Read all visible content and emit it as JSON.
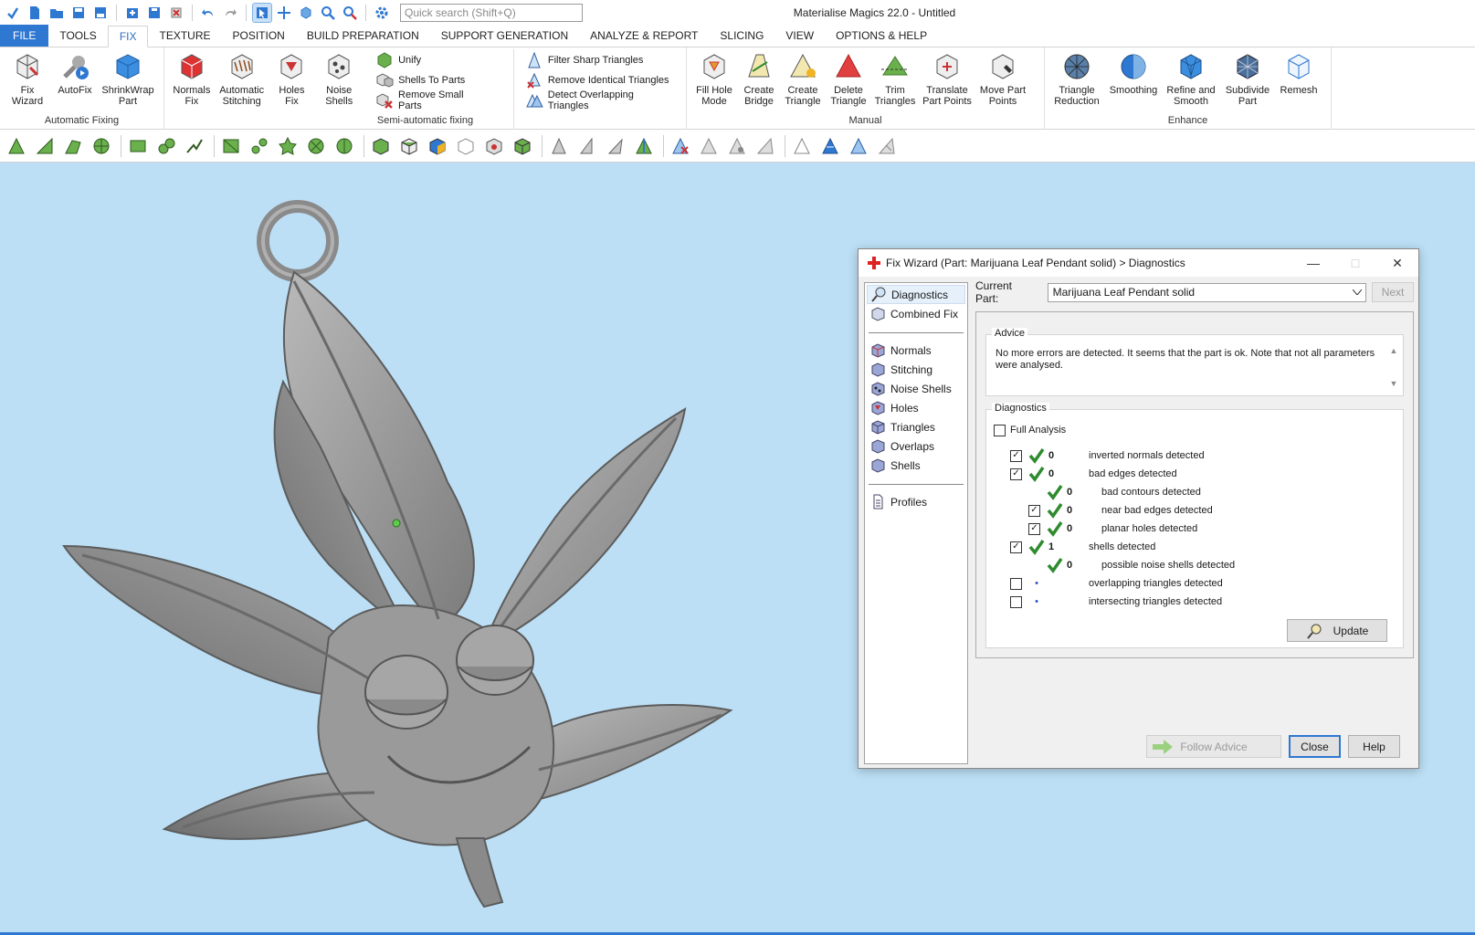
{
  "window": {
    "title": "Materialise Magics 22.0 - Untitled"
  },
  "search": {
    "placeholder": "Quick search (Shift+Q)"
  },
  "menu": {
    "tabs": [
      "FILE",
      "TOOLS",
      "FIX",
      "TEXTURE",
      "POSITION",
      "BUILD PREPARATION",
      "SUPPORT GENERATION",
      "ANALYZE & REPORT",
      "SLICING",
      "VIEW",
      "OPTIONS & HELP"
    ],
    "active": "FIX"
  },
  "ribbon": {
    "automatic_fixing": {
      "label": "Automatic Fixing",
      "buttons": [
        [
          "Fix",
          "Wizard"
        ],
        [
          "AutoFix",
          ""
        ],
        [
          "ShrinkWrap",
          "Part"
        ]
      ]
    },
    "semi": {
      "label": "Semi-automatic fixing",
      "big": [
        [
          "Normals",
          "Fix"
        ],
        [
          "Automatic",
          "Stitching"
        ],
        [
          "Holes",
          "Fix"
        ],
        [
          "Noise",
          "Shells"
        ]
      ],
      "small1": [
        "Unify",
        "Shells To Parts",
        "Remove Small Parts"
      ],
      "small2": [
        "Filter Sharp Triangles",
        "Remove Identical Triangles",
        "Detect Overlapping Triangles"
      ]
    },
    "manual": {
      "label": "Manual",
      "buttons": [
        [
          "Fill Hole",
          "Mode"
        ],
        [
          "Create",
          "Bridge"
        ],
        [
          "Create",
          "Triangle"
        ],
        [
          "Delete",
          "Triangle"
        ],
        [
          "Trim",
          "Triangles"
        ],
        [
          "Translate",
          "Part Points"
        ],
        [
          "Move Part",
          "Points"
        ]
      ]
    },
    "enhance": {
      "label": "Enhance",
      "buttons": [
        [
          "Triangle",
          "Reduction"
        ],
        [
          "Smoothing",
          ""
        ],
        [
          "Refine and",
          "Smooth"
        ],
        [
          "Subdivide",
          "Part"
        ],
        [
          "Remesh",
          ""
        ]
      ]
    }
  },
  "dialog": {
    "title": "Fix Wizard (Part: Marijuana Leaf Pendant solid) > Diagnostics",
    "sidebar": {
      "top": [
        "Diagnostics",
        "Combined Fix"
      ],
      "mid": [
        "Normals",
        "Stitching",
        "Noise Shells",
        "Holes",
        "Triangles",
        "Overlaps",
        "Shells"
      ],
      "bottom": [
        "Profiles"
      ]
    },
    "current_part_label": "Current Part:",
    "current_part_value": "Marijuana Leaf Pendant solid",
    "next": "Next",
    "advice_legend": "Advice",
    "advice_text": "No more errors are detected. It seems that the part is ok. Note that not all parameters were analysed.",
    "diagnostics_legend": "Diagnostics",
    "full_analysis": "Full Analysis",
    "rows": [
      {
        "cb": true,
        "ok": true,
        "n": "0",
        "t": "inverted normals detected",
        "indent": 0
      },
      {
        "cb": true,
        "ok": true,
        "n": "0",
        "t": "bad edges detected",
        "indent": 0
      },
      {
        "cb": null,
        "ok": true,
        "n": "0",
        "t": "bad contours detected",
        "indent": 1
      },
      {
        "cb": true,
        "ok": true,
        "n": "0",
        "t": "near bad edges detected",
        "indent": 1
      },
      {
        "cb": true,
        "ok": true,
        "n": "0",
        "t": "planar holes detected",
        "indent": 1
      },
      {
        "cb": true,
        "ok": true,
        "n": "1",
        "t": "shells detected",
        "indent": 0
      },
      {
        "cb": null,
        "ok": true,
        "n": "0",
        "t": "possible noise shells detected",
        "indent": 1
      },
      {
        "cb": false,
        "ok": false,
        "n": "",
        "t": "overlapping triangles detected",
        "indent": 0
      },
      {
        "cb": false,
        "ok": false,
        "n": "",
        "t": "intersecting triangles detected",
        "indent": 0
      }
    ],
    "update": "Update",
    "follow_advice": "Follow Advice",
    "close": "Close",
    "help": "Help"
  },
  "colors": {
    "accent": "#2f78d2",
    "viewport": "#bcdff5",
    "check": "#2e8b2e",
    "model": "#8e8e8e"
  }
}
